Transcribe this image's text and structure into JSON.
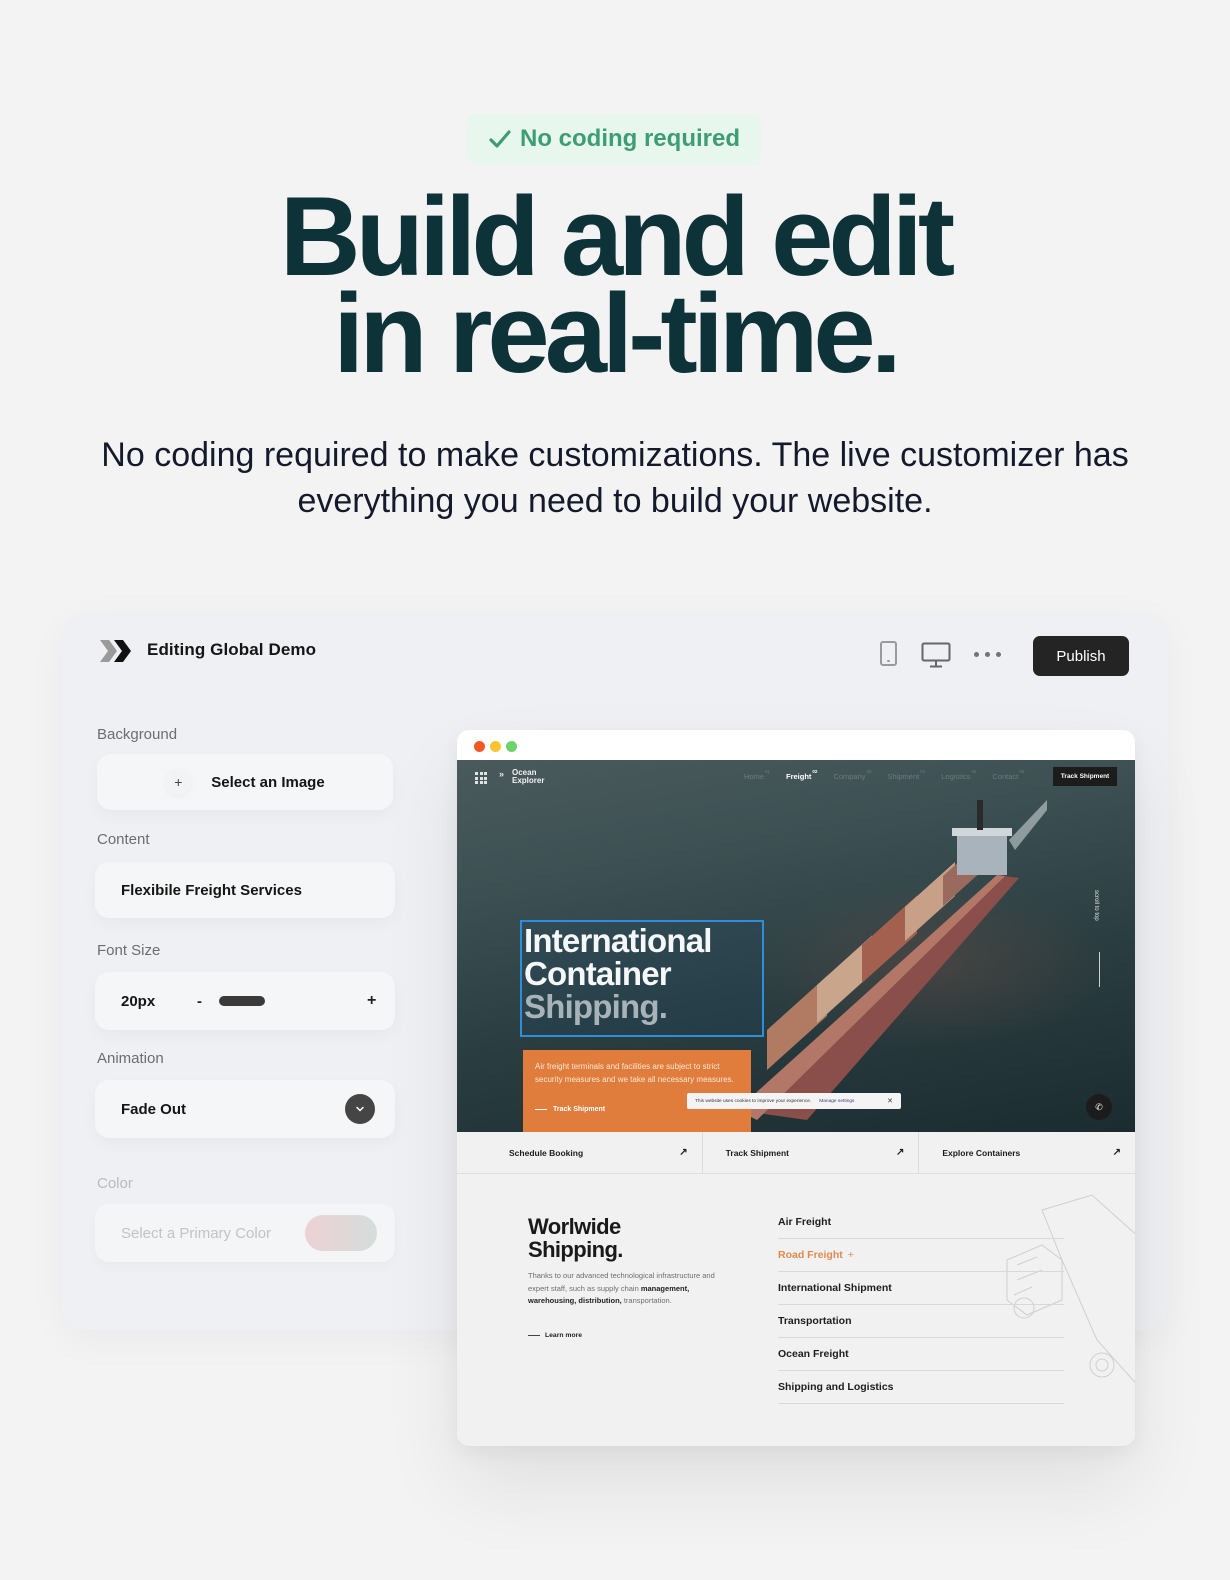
{
  "badge": {
    "icon": "checkmark-icon",
    "label": "No coding required"
  },
  "headline": {
    "line1": "Build and edit",
    "line2": "in real-time."
  },
  "subheading": "No coding required to make customizations. The live customizer has everything you need to build your website.",
  "editor": {
    "title": "Editing Global Demo",
    "logo_icon": "double-chevron-logo-icon",
    "toolbar": {
      "mobile_view_icon": "mobile-device-icon",
      "desktop_view_icon": "desktop-monitor-icon",
      "more_icon": "more-options-icon",
      "publish_label": "Publish"
    },
    "fields": {
      "background": {
        "label": "Background",
        "button_icon": "plus-icon",
        "button_label": "Select an Image"
      },
      "content": {
        "label": "Content",
        "value": "Flexibile Freight Services"
      },
      "font_size": {
        "label": "Font Size",
        "value": "20px",
        "decrement": "-",
        "increment": "+",
        "slider_fraction": 0.33
      },
      "animation": {
        "label": "Animation",
        "value": "Fade Out",
        "dropdown_icon": "chevron-down-icon"
      },
      "color": {
        "label": "Color",
        "placeholder": "Select a Primary Color",
        "swatch_from": "#ecc5c8",
        "swatch_to": "#c9d6d1"
      }
    }
  },
  "preview": {
    "window_dots": [
      "#f05a22",
      "#f8c431",
      "#6dd36c"
    ],
    "site": {
      "brand": {
        "arrows": "»",
        "name_line1": "Ocean",
        "name_line2": "Explorer"
      },
      "nav": [
        {
          "label": "Home",
          "active": false,
          "sup": "01"
        },
        {
          "label": "Freight",
          "active": true,
          "sup": "02"
        },
        {
          "label": "Company",
          "active": false,
          "sup": "03"
        },
        {
          "label": "Shipment",
          "active": false,
          "sup": "04"
        },
        {
          "label": "Logistics",
          "active": false,
          "sup": "05"
        },
        {
          "label": "Contact",
          "active": false,
          "sup": "06"
        }
      ],
      "nav_button": "Track Shipment",
      "hero": {
        "title_line1": "International",
        "title_line2": "Container",
        "title_line3": "Shipping.",
        "description": "Air freight terminals and facilities are subject to strict security measures and we take all necessary measures.",
        "link": "Track Shipment",
        "scroll_label": "scroll to top",
        "phone_icon": "phone-icon"
      },
      "cookie": {
        "text": "This website uses cookies to improve your experience.",
        "manage": "Manage settings",
        "close": "✕"
      },
      "quick_links": [
        {
          "label": "Schedule Booking",
          "icon": "arrow-up-right-icon"
        },
        {
          "label": "Track Shipment",
          "icon": "arrow-up-right-icon"
        },
        {
          "label": "Explore Containers",
          "icon": "arrow-up-right-icon"
        }
      ],
      "worldwide": {
        "title_line1": "Worlwide",
        "title_line2": "Shipping.",
        "body_plain": "Thanks to our advanced technological infrastructure and expert staff, such as supply chain ",
        "body_bold": "management, warehousing, distribution,",
        "body_end": " transportation.",
        "link": "Learn more"
      },
      "services": [
        {
          "label": "Air Freight",
          "active": false
        },
        {
          "label": "Road Freight",
          "active": true,
          "suffix": "+"
        },
        {
          "label": "International Shipment",
          "active": false
        },
        {
          "label": "Transportation",
          "active": false
        },
        {
          "label": "Ocean Freight",
          "active": false
        },
        {
          "label": "Shipping and Logistics",
          "active": false
        }
      ]
    }
  }
}
